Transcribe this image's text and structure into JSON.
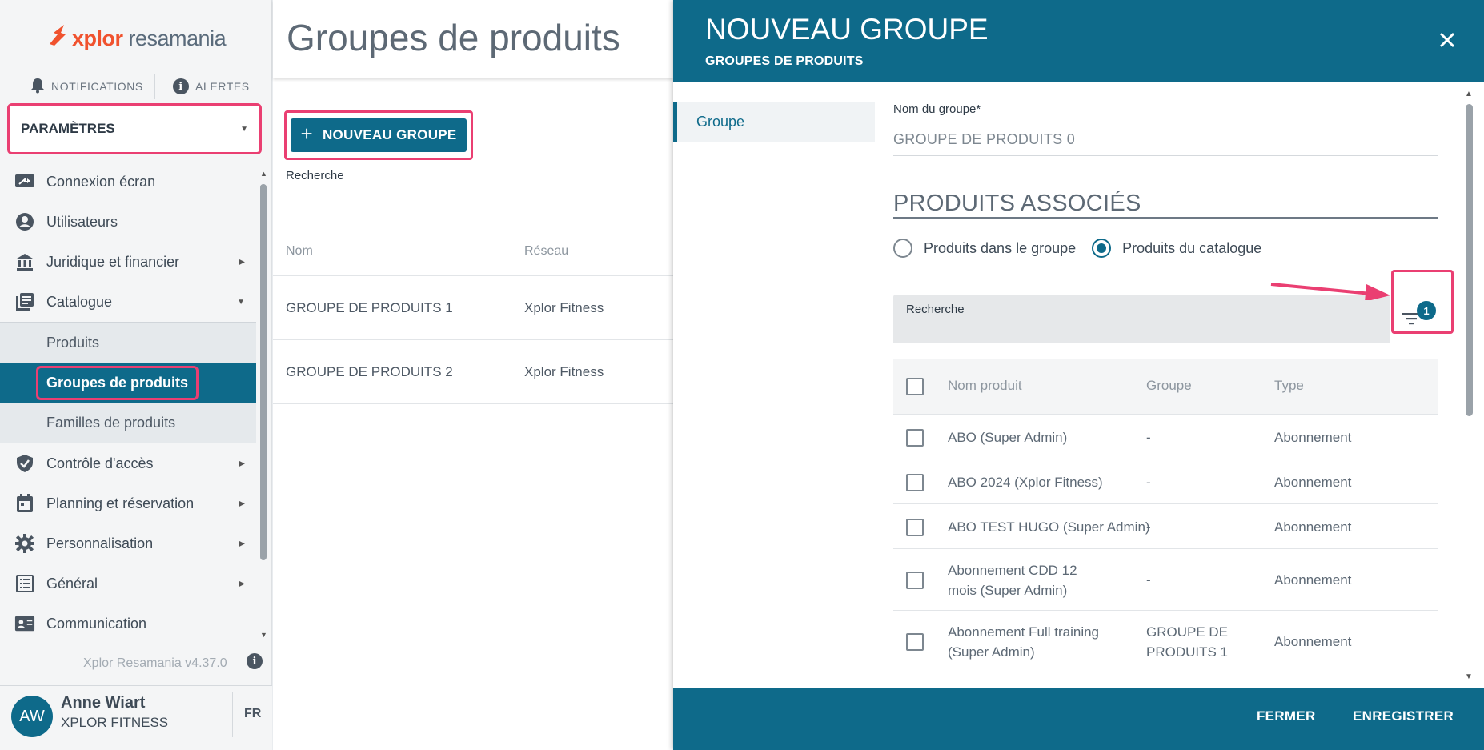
{
  "sidebar": {
    "logo": {
      "brand": "xplor",
      "product": "resamania"
    },
    "notifications_label": "NOTIFICATIONS",
    "alerts_label": "ALERTES",
    "settings_label": "PARAMÈTRES",
    "items": [
      {
        "label": "Connexion écran",
        "icon": "screen-login-icon"
      },
      {
        "label": "Utilisateurs",
        "icon": "user-circle-icon"
      },
      {
        "label": "Juridique et financier",
        "icon": "bank-icon"
      },
      {
        "label": "Catalogue",
        "icon": "catalogue-icon"
      },
      {
        "label": "Contrôle d'accès",
        "icon": "shield-check-icon"
      },
      {
        "label": "Planning et réservation",
        "icon": "calendar-icon"
      },
      {
        "label": "Personnalisation",
        "icon": "gear-icon"
      },
      {
        "label": "Général",
        "icon": "list-icon"
      },
      {
        "label": "Communication",
        "icon": "contact-card-icon"
      }
    ],
    "catalogue_sub": [
      {
        "label": "Produits"
      },
      {
        "label": "Groupes de produits"
      },
      {
        "label": "Familles de produits"
      }
    ],
    "version": "Xplor Resamania v4.37.0",
    "user": {
      "initials": "AW",
      "name": "Anne Wiart",
      "org": "XPLOR FITNESS",
      "lang": "FR"
    }
  },
  "main": {
    "title": "Groupes de produits",
    "new_button": "NOUVEAU GROUPE",
    "search_label": "Recherche",
    "columns": [
      "Nom",
      "Réseau"
    ],
    "rows": [
      {
        "name": "GROUPE DE PRODUITS 1",
        "network": "Xplor Fitness"
      },
      {
        "name": "GROUPE DE PRODUITS 2",
        "network": "Xplor Fitness"
      }
    ]
  },
  "dialog": {
    "title": "NOUVEAU GROUPE",
    "subtitle": "GROUPES DE PRODUITS",
    "nav_item": "Groupe",
    "group_name_label": "Nom du groupe*",
    "group_name_value": "GROUPE DE PRODUITS 0",
    "section_title": "PRODUITS ASSOCIÉS",
    "radio_options": [
      {
        "label": "Produits dans le groupe",
        "selected": false
      },
      {
        "label": "Produits du catalogue",
        "selected": true
      }
    ],
    "search_label": "Recherche",
    "filter_badge": "1",
    "columns": [
      "Nom produit",
      "Groupe",
      "Type"
    ],
    "products": [
      {
        "name": "ABO (Super Admin)",
        "group": "-",
        "type": "Abonnement"
      },
      {
        "name": "ABO 2024 (Xplor Fitness)",
        "group": "-",
        "type": "Abonnement"
      },
      {
        "name": "ABO TEST HUGO (Super Admin)",
        "group": "-",
        "type": "Abonnement"
      },
      {
        "name": "Abonnement CDD 12 mois (Super Admin)",
        "group": "-",
        "type": "Abonnement"
      },
      {
        "name": "Abonnement Full training (Super Admin)",
        "group": "GROUPE DE PRODUITS 1",
        "type": "Abonnement"
      }
    ],
    "close_button": "FERMER",
    "save_button": "ENREGISTRER"
  },
  "colors": {
    "primary": "#0e6a8a",
    "brand": "#f0522e",
    "highlight": "#ea3f72"
  }
}
